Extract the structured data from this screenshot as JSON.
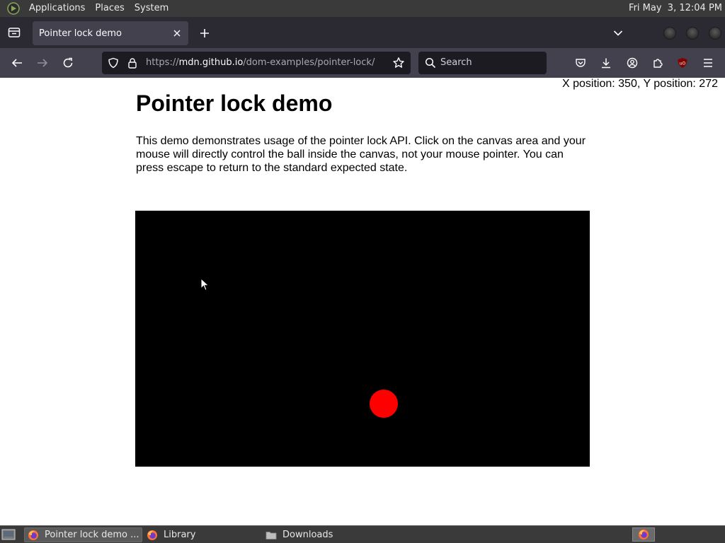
{
  "top_panel": {
    "menus": [
      "Applications",
      "Places",
      "System"
    ],
    "clock": "Fri May  3, 12:04 PM"
  },
  "browser": {
    "tab": {
      "title": "Pointer lock demo"
    },
    "url": {
      "scheme": "https://",
      "host": "mdn.github.io",
      "path": "/dom-examples/pointer-lock/"
    },
    "search_placeholder": "Search",
    "icons": {
      "back": "back-arrow-icon",
      "forward": "forward-arrow-icon",
      "reload": "reload-icon",
      "shield": "tracking-protection-shield-icon",
      "lock": "lock-icon",
      "bookmark": "star-icon",
      "pocket": "pocket-icon",
      "downloads": "download-icon",
      "account": "account-icon",
      "extensions": "puzzle-icon",
      "ublock": "ublock-icon",
      "menu": "hamburger-menu-icon"
    }
  },
  "page": {
    "position_readout": "X position: 350, Y position: 272",
    "title": "Pointer lock demo",
    "description": "This demo demonstrates usage of the pointer lock API. Click on the canvas area and your mouse will directly control the ball inside the canvas, not your mouse pointer. You can press escape to return to the standard expected state.",
    "canvas_background": "#000000",
    "ball_color": "#ff0000"
  },
  "taskbar": {
    "items": [
      {
        "label": "Pointer lock demo ...",
        "icon": "firefox-icon",
        "active": true
      },
      {
        "label": "Library",
        "icon": "firefox-icon",
        "active": false
      },
      {
        "label": "Downloads",
        "icon": "folder-icon",
        "active": false
      }
    ]
  }
}
